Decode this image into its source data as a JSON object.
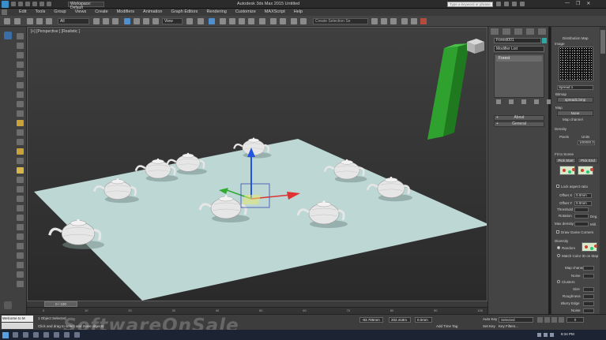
{
  "titlebar": {
    "workspace": "Workspace: Default",
    "title": "Autodesk 3ds Max 2015    Untitled",
    "search_placeholder": "Type a keyword or phrase",
    "window_controls": [
      "—",
      "❐",
      "✕"
    ]
  },
  "menubar": {
    "items": [
      "Edit",
      "Tools",
      "Group",
      "Views",
      "Create",
      "Modifiers",
      "Animation",
      "Graph Editors",
      "Rendering",
      "Customize",
      "MAXScript",
      "Help"
    ]
  },
  "toolbar": {
    "selection_filter": "All",
    "reference_coord": "View",
    "named_selection_placeholder": "Create Selection Se"
  },
  "viewport": {
    "label": "[+] [Perspective ] [Realistic ]"
  },
  "command_panel": {
    "object_name": "Forest001",
    "modifier_list": "Modifier List",
    "stack_item": "Forest",
    "rollouts": [
      "About",
      "General"
    ]
  },
  "distribution_map": {
    "title": "Distribution Map",
    "image_label": "Image",
    "preset": "Spread 1",
    "bitmap_label": "Bitmap",
    "bitmap_file": "spread1.bmp",
    "map_label": "Map",
    "map_value": "None",
    "map_channel": "Map channel",
    "density_label": "Density",
    "pixels": "Pixels",
    "units": "Units",
    "density_value": "100000.0",
    "fit_to_scene": "Fit to Scene",
    "pick_start": "Pick Start",
    "pick_end": "Pick End",
    "lock_aspect": "Lock aspect ratio",
    "offset_x_label": "Offset X",
    "offset_x": "0.0mm",
    "offset_y_label": "Offset Y",
    "offset_y": "0.0mm",
    "threshold_label": "Threshold",
    "rotation_label": "Rotation",
    "rotation_unit": "Deg.",
    "max_density_label": "Max density",
    "max_density_unit": "Mill.",
    "draw_corners": "Draw Game Corners",
    "diversity_label": "Diversity",
    "random": "Random",
    "match_color": "Match Color ID on Map",
    "map_channel2": "Map channel",
    "noise": "Noise",
    "clusters": "Clusters",
    "size": "Size",
    "roughness": "Roughness",
    "blurry_edge": "Blurry Edge",
    "noise2": "Noise"
  },
  "timeline": {
    "slider_label": "0 / 100",
    "ticks": [
      "0",
      "10",
      "20",
      "30",
      "40",
      "50",
      "60",
      "70",
      "80",
      "90",
      "100"
    ]
  },
  "status": {
    "maxscript_text": "Welcome to M",
    "objects_selected": "1 Object Selected",
    "prompt": "Click and drag to select and move objects",
    "x_value": "-93.785mm",
    "y_value": "202.418m",
    "z_value": "0.0mm",
    "add_time_tag": "Add Time Tag",
    "auto_key": "Auto Key",
    "set_key": "Set Key",
    "selected": "Selected",
    "key_filters": "Key Filters...",
    "frame": "0",
    "grid_info": "Grid = 10.0mm"
  },
  "taskbar": {
    "time": "8:34 PM",
    "status_text": "Đang ghi [00:00:28]"
  },
  "watermark": "SoftwareOnSale",
  "colors": {
    "plane": "#bcd7d4",
    "pillar": "#2ea12e",
    "gizmo_x": "#d33",
    "gizmo_y": "#3a3",
    "gizmo_z": "#2255dd"
  }
}
